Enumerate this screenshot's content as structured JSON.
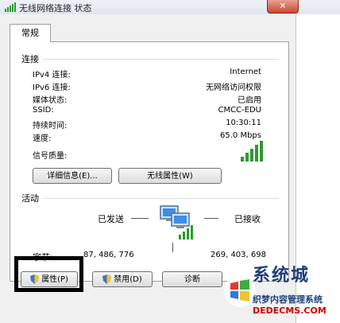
{
  "window": {
    "title": "无线网络连接 状态",
    "close_label": "✕"
  },
  "tabs": [
    {
      "label": "常规"
    }
  ],
  "connection": {
    "section_title": "连接",
    "rows": [
      {
        "label": "IPv4 连接:",
        "value": "Internet"
      },
      {
        "label": "IPv6 连接:",
        "value": "无网络访问权限"
      },
      {
        "label": "媒体状态:",
        "value": "已启用"
      },
      {
        "label": "SSID:",
        "value": "CMCC-EDU"
      },
      {
        "label": "持续时间:",
        "value": "10:30:11"
      },
      {
        "label": "速度:",
        "value": "65.0 Mbps"
      }
    ],
    "signal_label": "信号质量:",
    "signal_bars": 5,
    "buttons": {
      "details": "详细信息(E)...",
      "wireless_properties": "无线属性(W)"
    }
  },
  "activity": {
    "section_title": "活动",
    "sent_label": "已发送",
    "received_label": "已接收",
    "bytes_label": "字节:",
    "bytes_sent": "87, 486, 776",
    "bytes_received": "269, 403, 698"
  },
  "footer_buttons": {
    "properties": "属性(P)",
    "disable": "禁用(D)",
    "diagnose": "诊断"
  },
  "watermark": {
    "brand": "系统城",
    "subtitle": "织梦内容管理系统",
    "url": "DEDECMS.COM"
  },
  "colors": {
    "signal_green": "#2e9a2e",
    "highlight_border": "#000000",
    "section_rule": "#d5dfe5"
  }
}
